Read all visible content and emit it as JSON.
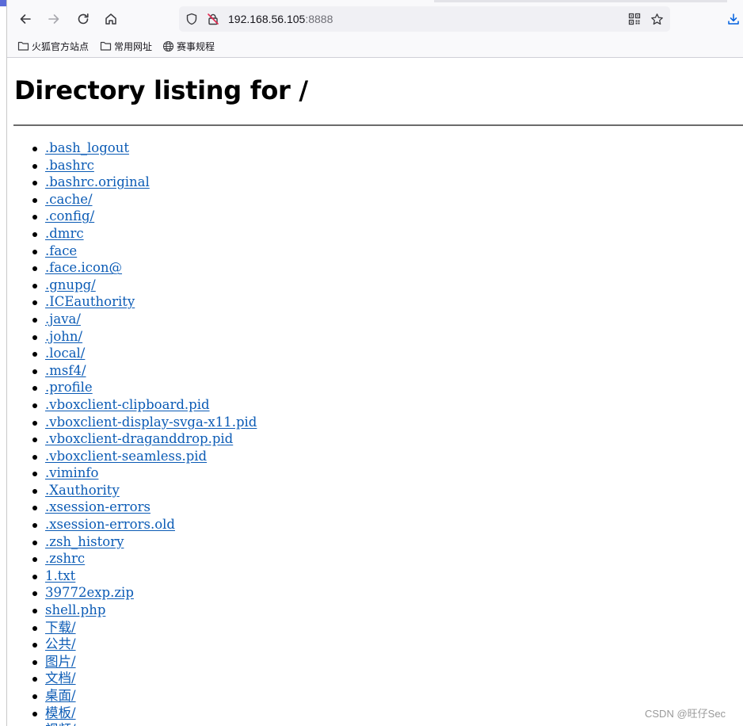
{
  "browser": {
    "url_host": "192.168.56.105",
    "url_port": ":8888",
    "toolbar_icons": [
      "back-icon",
      "forward-icon",
      "reload-icon",
      "home-icon",
      "shield-icon",
      "insecure-lock-icon",
      "qr-code-icon",
      "star-icon",
      "download-icon"
    ],
    "bookmarks": [
      {
        "label": "火狐官方站点",
        "icon": "folder-icon"
      },
      {
        "label": "常用网址",
        "icon": "folder-icon"
      },
      {
        "label": "赛事规程",
        "icon": "globe-icon"
      }
    ]
  },
  "page": {
    "title": "Directory listing for /",
    "entries": [
      ".bash_logout",
      ".bashrc",
      ".bashrc.original",
      ".cache/",
      ".config/",
      ".dmrc",
      ".face",
      ".face.icon@",
      ".gnupg/",
      ".ICEauthority",
      ".java/",
      ".john/",
      ".local/",
      ".msf4/",
      ".profile",
      ".vboxclient-clipboard.pid",
      ".vboxclient-display-svga-x11.pid",
      ".vboxclient-draganddrop.pid",
      ".vboxclient-seamless.pid",
      ".viminfo",
      ".Xauthority",
      ".xsession-errors",
      ".xsession-errors.old",
      ".zsh_history",
      ".zshrc",
      "1.txt",
      "39772exp.zip",
      "shell.php",
      "下载/",
      "公共/",
      "图片/",
      "文档/",
      "桌面/",
      "模板/",
      "视频/"
    ]
  },
  "watermark": "CSDN @旺仔Sec",
  "colors": {
    "link": "#0b5bb5",
    "chrome_bg": "#f9f9fb",
    "urlbar_bg": "#f0f0f4",
    "download_accent": "#0060df"
  }
}
